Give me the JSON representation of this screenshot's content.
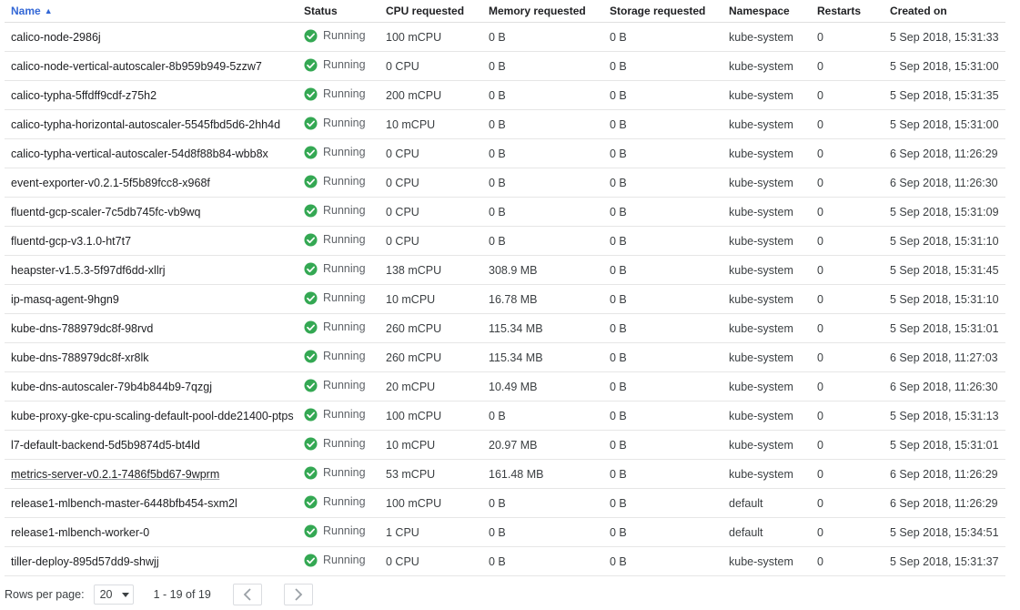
{
  "table": {
    "columns": [
      {
        "key": "name",
        "label": "Name"
      },
      {
        "key": "status",
        "label": "Status"
      },
      {
        "key": "cpu",
        "label": "CPU requested"
      },
      {
        "key": "memory",
        "label": "Memory requested"
      },
      {
        "key": "storage",
        "label": "Storage requested"
      },
      {
        "key": "namespace",
        "label": "Namespace"
      },
      {
        "key": "restarts",
        "label": "Restarts"
      },
      {
        "key": "created",
        "label": "Created on"
      }
    ],
    "sort": {
      "column": "Name",
      "direction": "ascending",
      "icon": "sort-ascending-icon"
    },
    "status_icon": "check-circle-icon",
    "status_color": "#34a853",
    "rows": [
      {
        "name": "calico-node-2986j",
        "status": "Running",
        "cpu": "100 mCPU",
        "memory": "0 B",
        "storage": "0 B",
        "namespace": "kube-system",
        "restarts": "0",
        "created": "5 Sep 2018, 15:31:33"
      },
      {
        "name": "calico-node-vertical-autoscaler-8b959b949-5zzw7",
        "status": "Running",
        "cpu": "0 CPU",
        "memory": "0 B",
        "storage": "0 B",
        "namespace": "kube-system",
        "restarts": "0",
        "created": "5 Sep 2018, 15:31:00"
      },
      {
        "name": "calico-typha-5ffdff9cdf-z75h2",
        "status": "Running",
        "cpu": "200 mCPU",
        "memory": "0 B",
        "storage": "0 B",
        "namespace": "kube-system",
        "restarts": "0",
        "created": "5 Sep 2018, 15:31:35"
      },
      {
        "name": "calico-typha-horizontal-autoscaler-5545fbd5d6-2hh4d",
        "status": "Running",
        "cpu": "10 mCPU",
        "memory": "0 B",
        "storage": "0 B",
        "namespace": "kube-system",
        "restarts": "0",
        "created": "5 Sep 2018, 15:31:00"
      },
      {
        "name": "calico-typha-vertical-autoscaler-54d8f88b84-wbb8x",
        "status": "Running",
        "cpu": "0 CPU",
        "memory": "0 B",
        "storage": "0 B",
        "namespace": "kube-system",
        "restarts": "0",
        "created": "6 Sep 2018, 11:26:29"
      },
      {
        "name": "event-exporter-v0.2.1-5f5b89fcc8-x968f",
        "status": "Running",
        "cpu": "0 CPU",
        "memory": "0 B",
        "storage": "0 B",
        "namespace": "kube-system",
        "restarts": "0",
        "created": "6 Sep 2018, 11:26:30"
      },
      {
        "name": "fluentd-gcp-scaler-7c5db745fc-vb9wq",
        "status": "Running",
        "cpu": "0 CPU",
        "memory": "0 B",
        "storage": "0 B",
        "namespace": "kube-system",
        "restarts": "0",
        "created": "5 Sep 2018, 15:31:09"
      },
      {
        "name": "fluentd-gcp-v3.1.0-ht7t7",
        "status": "Running",
        "cpu": "0 CPU",
        "memory": "0 B",
        "storage": "0 B",
        "namespace": "kube-system",
        "restarts": "0",
        "created": "5 Sep 2018, 15:31:10"
      },
      {
        "name": "heapster-v1.5.3-5f97df6dd-xllrj",
        "status": "Running",
        "cpu": "138 mCPU",
        "memory": "308.9 MB",
        "storage": "0 B",
        "namespace": "kube-system",
        "restarts": "0",
        "created": "5 Sep 2018, 15:31:45"
      },
      {
        "name": "ip-masq-agent-9hgn9",
        "status": "Running",
        "cpu": "10 mCPU",
        "memory": "16.78 MB",
        "storage": "0 B",
        "namespace": "kube-system",
        "restarts": "0",
        "created": "5 Sep 2018, 15:31:10"
      },
      {
        "name": "kube-dns-788979dc8f-98rvd",
        "status": "Running",
        "cpu": "260 mCPU",
        "memory": "115.34 MB",
        "storage": "0 B",
        "namespace": "kube-system",
        "restarts": "0",
        "created": "5 Sep 2018, 15:31:01"
      },
      {
        "name": "kube-dns-788979dc8f-xr8lk",
        "status": "Running",
        "cpu": "260 mCPU",
        "memory": "115.34 MB",
        "storage": "0 B",
        "namespace": "kube-system",
        "restarts": "0",
        "created": "6 Sep 2018, 11:27:03"
      },
      {
        "name": "kube-dns-autoscaler-79b4b844b9-7qzgj",
        "status": "Running",
        "cpu": "20 mCPU",
        "memory": "10.49 MB",
        "storage": "0 B",
        "namespace": "kube-system",
        "restarts": "0",
        "created": "6 Sep 2018, 11:26:30"
      },
      {
        "name": "kube-proxy-gke-cpu-scaling-default-pool-dde21400-ptps",
        "status": "Running",
        "cpu": "100 mCPU",
        "memory": "0 B",
        "storage": "0 B",
        "namespace": "kube-system",
        "restarts": "0",
        "created": "5 Sep 2018, 15:31:13"
      },
      {
        "name": "l7-default-backend-5d5b9874d5-bt4ld",
        "status": "Running",
        "cpu": "10 mCPU",
        "memory": "20.97 MB",
        "storage": "0 B",
        "namespace": "kube-system",
        "restarts": "0",
        "created": "5 Sep 2018, 15:31:01"
      },
      {
        "name": "metrics-server-v0.2.1-7486f5bd67-9wprm",
        "status": "Running",
        "cpu": "53 mCPU",
        "memory": "161.48 MB",
        "storage": "0 B",
        "namespace": "kube-system",
        "restarts": "0",
        "created": "6 Sep 2018, 11:26:29",
        "underlined": true
      },
      {
        "name": "release1-mlbench-master-6448bfb454-sxm2l",
        "status": "Running",
        "cpu": "100 mCPU",
        "memory": "0 B",
        "storage": "0 B",
        "namespace": "default",
        "restarts": "0",
        "created": "6 Sep 2018, 11:26:29"
      },
      {
        "name": "release1-mlbench-worker-0",
        "status": "Running",
        "cpu": "1 CPU",
        "memory": "0 B",
        "storage": "0 B",
        "namespace": "default",
        "restarts": "0",
        "created": "5 Sep 2018, 15:34:51"
      },
      {
        "name": "tiller-deploy-895d57dd9-shwjj",
        "status": "Running",
        "cpu": "0 CPU",
        "memory": "0 B",
        "storage": "0 B",
        "namespace": "kube-system",
        "restarts": "0",
        "created": "5 Sep 2018, 15:31:37"
      }
    ]
  },
  "footer": {
    "rows_per_page_label": "Rows per page:",
    "rows_per_page_value": "20",
    "range_text": "1 - 19 of 19",
    "prev_icon": "chevron-left-icon",
    "next_icon": "chevron-right-icon"
  }
}
